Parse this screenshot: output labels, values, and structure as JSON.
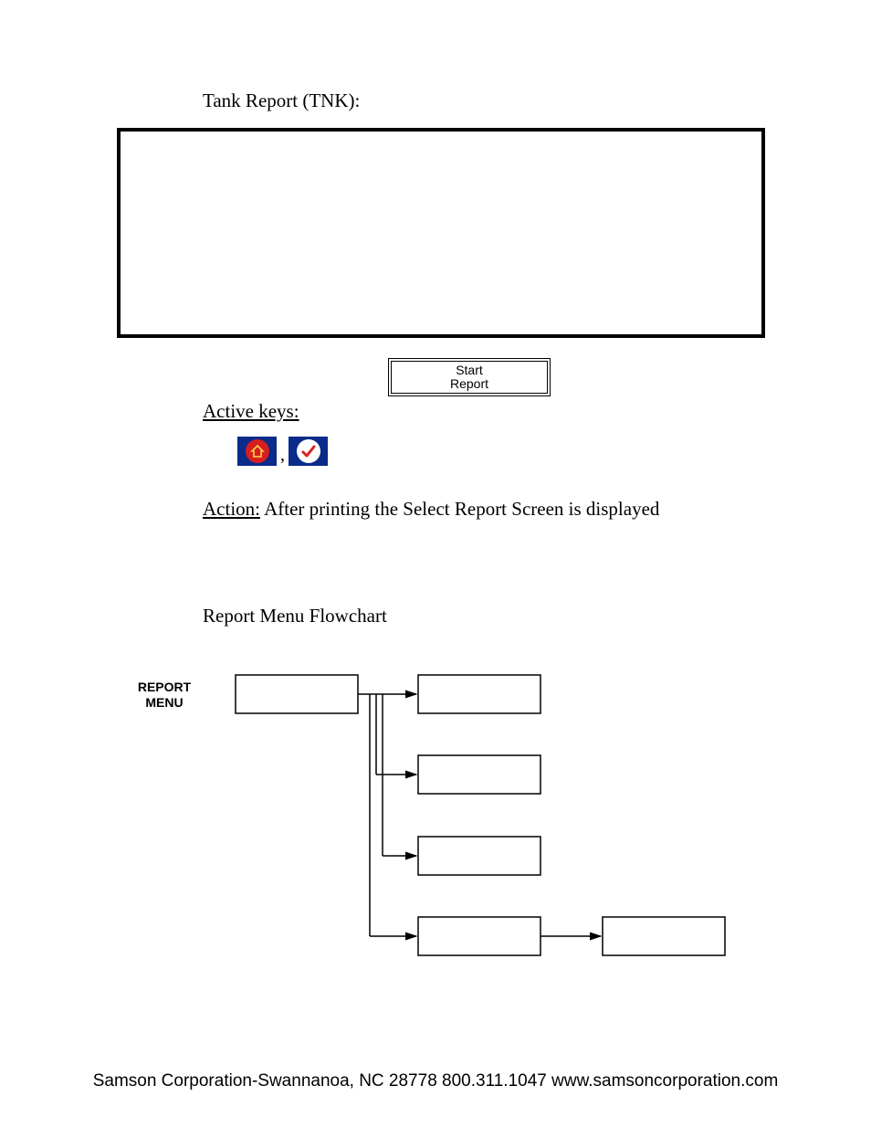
{
  "title": "Tank Report (TNK):",
  "start_button": {
    "line1": "Start",
    "line2": "Report"
  },
  "active_keys_label": "Active keys:",
  "icons": {
    "home": "home-icon",
    "check": "check-icon",
    "separator": ","
  },
  "action": {
    "label": "Action:",
    "text": " After printing the Select Report Screen is displayed"
  },
  "flowchart": {
    "title": "Report Menu Flowchart",
    "root_label": "REPORT MENU"
  },
  "footer": "Samson Corporation-Swannanoa, NC 28778  800.311.1047 www.samsoncorporation.com"
}
